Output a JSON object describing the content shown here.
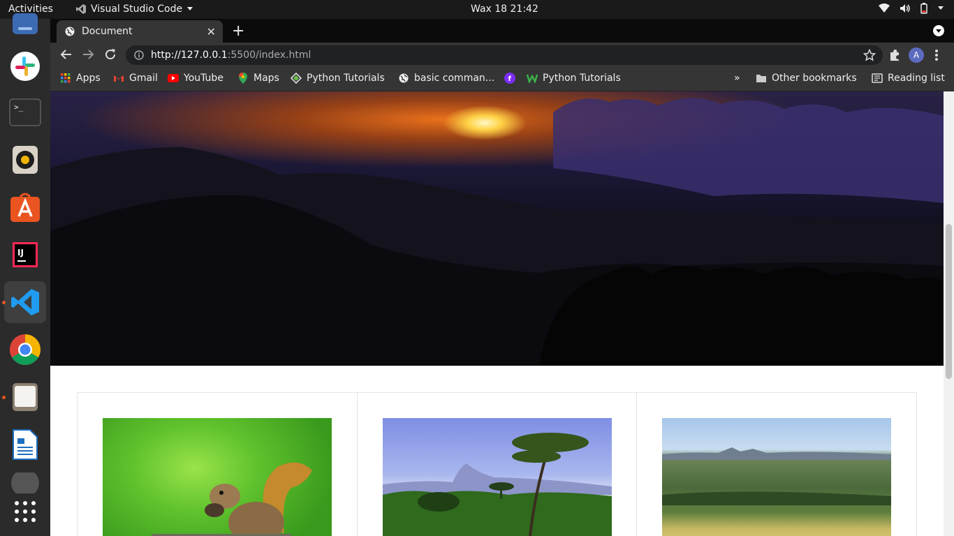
{
  "system_bar": {
    "activities": "Activities",
    "app_name": "Visual Studio Code",
    "clock": "Wax 18  21:42"
  },
  "dock": {
    "items": [
      "files",
      "slack",
      "terminal",
      "rhythmbox",
      "ubuntu-software",
      "intellij-idea",
      "visual-studio-code",
      "google-chrome",
      "files-manager",
      "libreoffice-writer",
      "show-applications"
    ]
  },
  "browser": {
    "tab_title": "Document",
    "url_host": "http://127.0.0.1",
    "url_rest": ":5500/index.html",
    "profile_initial": "A",
    "bookmarks": [
      {
        "label": "Apps",
        "icon": "apps-grid-icon"
      },
      {
        "label": "Gmail",
        "icon": "gmail-icon"
      },
      {
        "label": "YouTube",
        "icon": "youtube-icon"
      },
      {
        "label": "Maps",
        "icon": "maps-icon"
      },
      {
        "label": "Python Tutorials",
        "icon": "python-tutorials-icon"
      },
      {
        "label": "basic comman...",
        "icon": "globe-icon"
      },
      {
        "label": "",
        "icon": "f-icon"
      },
      {
        "label": "Python Tutorials",
        "icon": "w-icon"
      }
    ],
    "more_bookmarks": "»",
    "other_bookmarks": "Other bookmarks",
    "reading_list": "Reading list"
  },
  "colors": {
    "accent": "#e95420",
    "chrome_dark": "#353535",
    "profile": "#5c6bc0"
  }
}
